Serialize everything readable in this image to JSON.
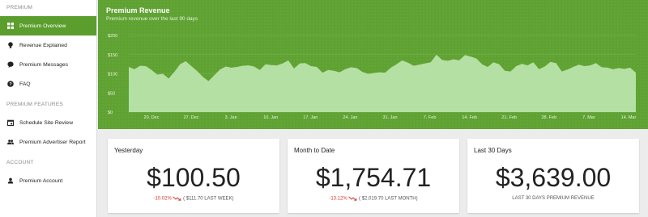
{
  "sidebar": {
    "sections": [
      {
        "label": "PREMIUM",
        "items": [
          {
            "label": "Premium Overview",
            "icon": "grid-icon",
            "active": true
          },
          {
            "label": "Revenue Explained",
            "icon": "lightbulb-icon"
          },
          {
            "label": "Premium Messages",
            "icon": "chat-bubble-icon"
          },
          {
            "label": "FAQ",
            "icon": "help-circle-icon"
          }
        ]
      },
      {
        "label": "PREMIUM FEATURES",
        "items": [
          {
            "label": "Schedule Site Review",
            "icon": "calendar-icon"
          },
          {
            "label": "Premium Advertiser Report",
            "icon": "people-icon"
          }
        ]
      },
      {
        "label": "ACCOUNT",
        "items": [
          {
            "label": "Premium Account",
            "icon": "person-icon"
          }
        ]
      }
    ]
  },
  "header": {
    "title": "Premium Revenue",
    "subtitle": "Premium revenue over the last 90 days"
  },
  "chart_data": {
    "type": "area",
    "y_ticks": [
      "$200",
      "$150",
      "$100",
      "$50",
      "$0"
    ],
    "ylim": [
      0,
      200
    ],
    "x_ticks": [
      "20. Dec",
      "27. Dec",
      "3. Jan",
      "10. Jan",
      "17. Jan",
      "24. Jan",
      "31. Jan",
      "7. Feb",
      "14. Feb",
      "21. Feb",
      "28. Feb",
      "7. Mar",
      "14. Mar"
    ],
    "values": [
      118,
      112,
      121,
      120,
      110,
      98,
      100,
      88,
      105,
      125,
      133,
      120,
      107,
      92,
      81,
      96,
      111,
      119,
      116,
      118,
      121,
      122,
      119,
      110,
      125,
      123,
      122,
      127,
      135,
      114,
      127,
      128,
      120,
      118,
      103,
      110,
      108,
      104,
      112,
      117,
      115,
      105,
      100,
      102,
      104,
      103,
      116,
      125,
      135,
      129,
      121,
      124,
      127,
      130,
      150,
      136,
      134,
      138,
      135,
      149,
      145,
      140,
      125,
      118,
      130,
      125,
      108,
      106,
      120,
      126,
      122,
      130,
      112,
      119,
      131,
      128,
      106,
      111,
      118,
      124,
      120,
      122,
      128,
      117,
      116,
      112,
      115,
      113,
      116,
      103
    ],
    "colors": {
      "area": "#b5e0a3",
      "background": "#5fa232"
    }
  },
  "cards": [
    {
      "title": "Yesterday",
      "value": "$100.50",
      "change": "-10.02%",
      "detail": "( $111.70 LAST WEEK)"
    },
    {
      "title": "Month to Date",
      "value": "$1,754.71",
      "change": "-13.12%",
      "detail": "( $2,019.70 LAST MONTH)"
    },
    {
      "title": "Last 30 Days",
      "value": "$3,639.00",
      "change": "",
      "detail": "LAST 30 DAYS PREMIUM REVENUE"
    }
  ],
  "colors": {
    "accent": "#5c9e2e",
    "negative": "#d33a2c"
  }
}
